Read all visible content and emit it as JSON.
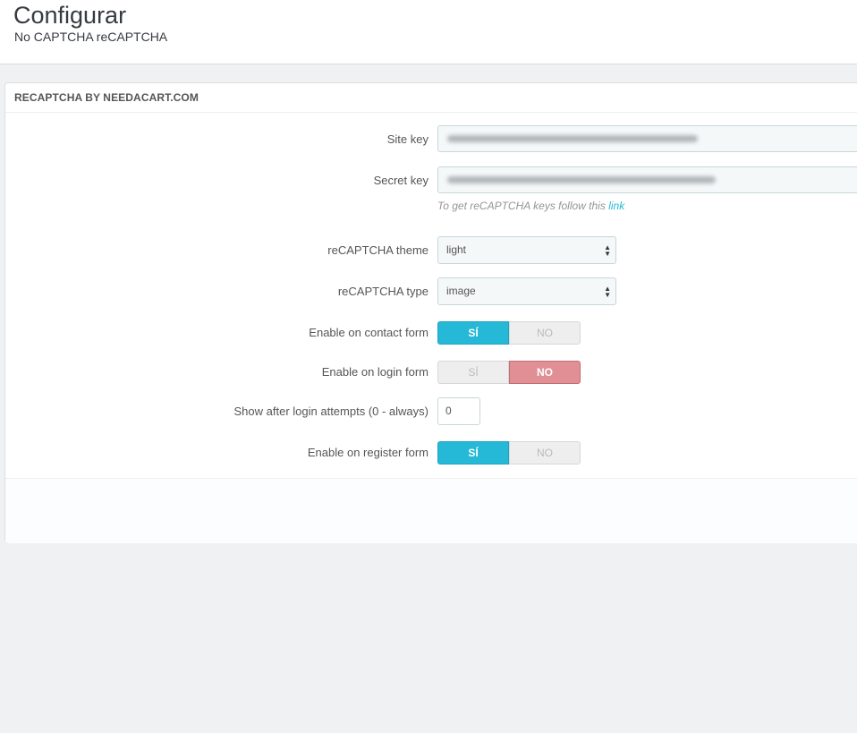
{
  "header": {
    "title": "Configurar",
    "subtitle": "No CAPTCHA reCAPTCHA"
  },
  "panel": {
    "heading": "RECAPTCHA BY NEEDACART.COM"
  },
  "fields": {
    "site_key": {
      "label": "Site key"
    },
    "secret_key": {
      "label": "Secret key"
    },
    "help_text": "To get reCAPTCHA keys follow this ",
    "help_link": "link",
    "theme": {
      "label": "reCAPTCHA theme",
      "value": "light"
    },
    "type": {
      "label": "reCAPTCHA type",
      "value": "image"
    },
    "contact_form": {
      "label": "Enable on contact form",
      "yes": "SÍ",
      "no": "NO",
      "selected": "yes"
    },
    "login_form": {
      "label": "Enable on login form",
      "yes": "SÍ",
      "no": "NO",
      "selected": "no"
    },
    "login_attempts": {
      "label": "Show after login attempts (0 - always)",
      "value": "0"
    },
    "register_form": {
      "label": "Enable on register form",
      "yes": "SÍ",
      "no": "NO",
      "selected": "yes"
    }
  },
  "colors": {
    "accent": "#25b9d7",
    "danger": "#e08f95"
  }
}
